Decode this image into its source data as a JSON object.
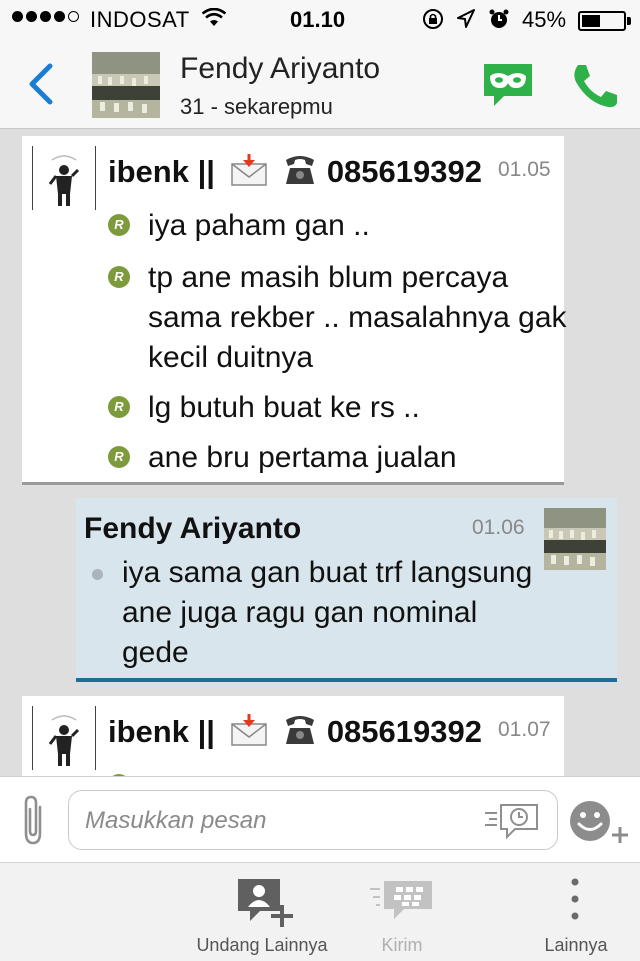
{
  "status_bar": {
    "carrier": "INDOSAT",
    "time": "01.10",
    "battery_percent": "45%",
    "battery_level": 0.45
  },
  "header": {
    "contact_name": "Fendy Ariyanto",
    "contact_status": "31 - sekarepmu"
  },
  "messages": [
    {
      "sender": "ibenk ||",
      "sender_phone": "085619392",
      "time": "01.05",
      "lines": [
        "iya paham gan ..",
        "tp ane masih blum percaya sama rekber .. masalahnya gak kecil duitnya",
        "lg butuh buat ke rs ..",
        "ane bru pertama jualan"
      ]
    },
    {
      "sender": "Fendy Ariyanto",
      "time": "01.06",
      "lines": [
        "iya sama gan buat trf langsung ane juga ragu gan nominal gede"
      ]
    },
    {
      "sender": "ibenk ||",
      "sender_phone": "085619392",
      "time": "01.07",
      "lines": []
    }
  ],
  "read_badge": "R",
  "composer": {
    "placeholder": "Masukkan pesan"
  },
  "toolbar": {
    "invite_label": "Undang Lainnya",
    "send_label": "Kirim",
    "more_label": "Lainnya"
  },
  "colors": {
    "accent_blue": "#1a7fd4",
    "bbm_green": "#2fb14a",
    "read_green": "#7d9b3c",
    "outgoing_bg": "#d8e5ec",
    "outgoing_border": "#1e6e9c"
  }
}
